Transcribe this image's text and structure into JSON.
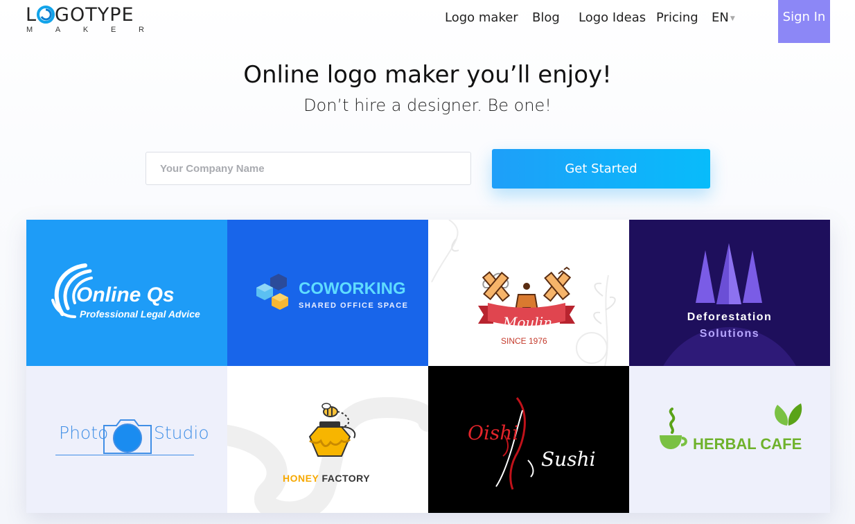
{
  "header": {
    "logo_text": "L GOTYPE",
    "logo_sub": [
      "M",
      "A",
      "K",
      "E",
      "R"
    ],
    "nav": [
      "Logo maker",
      "Blog",
      "Logo Ideas",
      "Pricing"
    ],
    "language": "EN",
    "signin_label": "Sign In"
  },
  "hero": {
    "title": "Online logo maker you’ll enjoy!",
    "subtitle": "Don’t hire a designer. Be one!",
    "input_placeholder": "Your Company Name",
    "input_value": "",
    "cta_label": "Get Started"
  },
  "logos": [
    {
      "name": "Online Qs",
      "tagline": "Professional Legal Advice",
      "bg": "#1e9cf7",
      "icon": "wave-swirl-icon"
    },
    {
      "name": "COWORKING",
      "tagline": "SHARED OFFICE SPACE",
      "bg": "#1865ea",
      "icon": "hexagon-stack-icon"
    },
    {
      "name": "Moulin",
      "tagline": "SINCE 1976",
      "bg": "#ffffff",
      "icon": "windmill-icon"
    },
    {
      "name": "Deforestation",
      "tagline": "Solutions",
      "bg": "#1e0f5c",
      "icon": "pine-trees-icon"
    },
    {
      "name": "Photo",
      "name2": "Studio",
      "bg": "#eef0fb",
      "icon": "camera-icon"
    },
    {
      "name": "HONEY",
      "name2": "FACTORY",
      "bg": "#ffffff",
      "icon": "honey-jar-bee-icon"
    },
    {
      "name": "Oishi",
      "name2": "Sushi",
      "bg": "#000000",
      "icon": "chopsticks-flourish-icon"
    },
    {
      "name": "HERBAL CAFE",
      "bg": "#eef0fb",
      "icon": "steaming-cup-leaves-icon"
    }
  ]
}
